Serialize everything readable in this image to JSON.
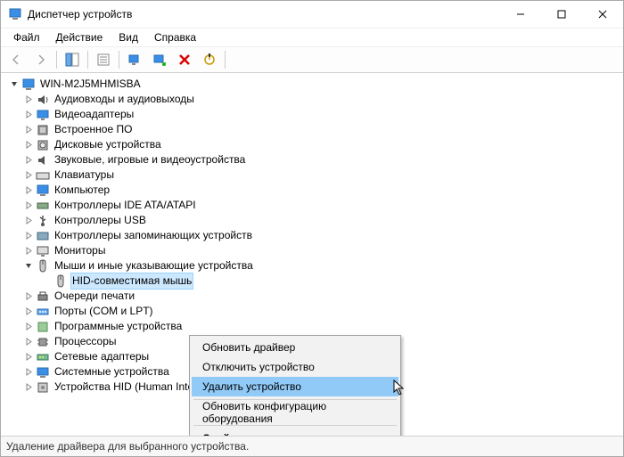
{
  "title": "Диспетчер устройств",
  "menubar": [
    "Файл",
    "Действие",
    "Вид",
    "Справка"
  ],
  "tree": {
    "root": "WIN-M2J5MHMISBA",
    "items": [
      {
        "label": "Аудиовходы и аудиовыходы",
        "icon": "audio"
      },
      {
        "label": "Видеоадаптеры",
        "icon": "display"
      },
      {
        "label": "Встроенное ПО",
        "icon": "firmware"
      },
      {
        "label": "Дисковые устройства",
        "icon": "disk"
      },
      {
        "label": "Звуковые, игровые и видеоустройства",
        "icon": "sound"
      },
      {
        "label": "Клавиатуры",
        "icon": "keyboard"
      },
      {
        "label": "Компьютер",
        "icon": "computer"
      },
      {
        "label": "Контроллеры IDE ATA/ATAPI",
        "icon": "ide"
      },
      {
        "label": "Контроллеры USB",
        "icon": "usb"
      },
      {
        "label": "Контроллеры запоминающих устройств",
        "icon": "storage"
      },
      {
        "label": "Мониторы",
        "icon": "monitor"
      },
      {
        "label": "Мыши и иные указывающие устройства",
        "icon": "mouse",
        "expanded": true,
        "children": [
          {
            "label": "HID-совместимая мышь",
            "icon": "mouse",
            "selected": true
          }
        ]
      },
      {
        "label": "Очереди печати",
        "icon": "printer"
      },
      {
        "label": "Порты (COM и LPT)",
        "icon": "port"
      },
      {
        "label": "Программные устройства",
        "icon": "software"
      },
      {
        "label": "Процессоры",
        "icon": "cpu"
      },
      {
        "label": "Сетевые адаптеры",
        "icon": "network"
      },
      {
        "label": "Системные устройства",
        "icon": "system"
      },
      {
        "label": "Устройства HID (Human Interface Devices)",
        "icon": "hid"
      }
    ]
  },
  "context_menu": {
    "items": [
      {
        "label": "Обновить драйвер",
        "hover": false
      },
      {
        "label": "Отключить устройство",
        "hover": false
      },
      {
        "label": "Удалить устройство",
        "hover": true
      },
      {
        "sep": true
      },
      {
        "label": "Обновить конфигурацию оборудования",
        "hover": false
      },
      {
        "sep": true
      },
      {
        "label": "Свойства",
        "bold": true
      }
    ]
  },
  "statusbar": "Удаление драйвера для выбранного устройства."
}
